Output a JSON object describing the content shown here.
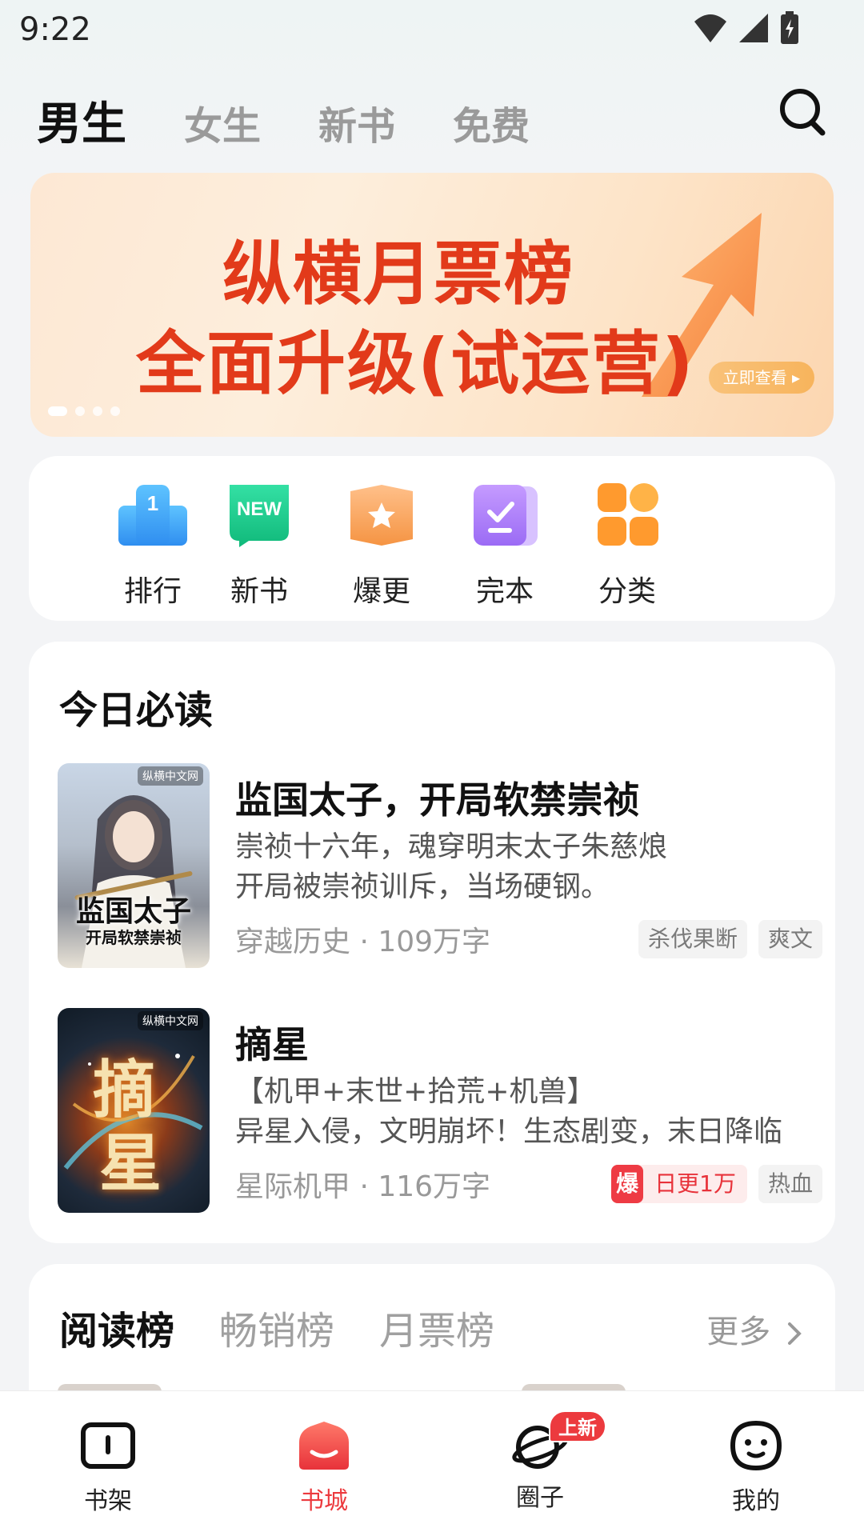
{
  "status_bar": {
    "time": "9:22"
  },
  "top_tabs": [
    "男生",
    "女生",
    "新书",
    "免费"
  ],
  "banner": {
    "line1": "纵横月票榜",
    "line2": "全面升级(试运营)",
    "cta": "立即查看 ▸",
    "slide_count": 4,
    "active_slide": 1
  },
  "quick_entries": [
    {
      "label": "排行",
      "icon": "rank-icon"
    },
    {
      "label": "新书",
      "icon": "new-book-icon"
    },
    {
      "label": "爆更",
      "icon": "burst-update-icon"
    },
    {
      "label": "完本",
      "icon": "completed-icon"
    },
    {
      "label": "分类",
      "icon": "category-icon"
    }
  ],
  "must_read": {
    "title": "今日必读",
    "books": [
      {
        "title": "监国太子，开局软禁崇祯",
        "desc_line1": "崇祯十六年，魂穿明末太子朱慈烺",
        "desc_line2": "开局被崇祯训斥，当场硬钢。",
        "meta": "穿越历史 · 109万字",
        "tags": [
          "杀伐果断",
          "爽文"
        ],
        "cover_text1": "监国太子",
        "cover_text2": "开局软禁崇祯",
        "cover_logo": "纵横中文网"
      },
      {
        "title": "摘星",
        "desc_line1": "【机甲+末世+拾荒+机兽】",
        "desc_line2": "异星入侵，文明崩坏！生态剧变，末日降临",
        "meta": "星际机甲 · 116万字",
        "hot_badge": "爆",
        "hot_tag": "日更1万",
        "tags": [
          "热血"
        ],
        "cover_text1": "摘",
        "cover_text2": "星",
        "cover_logo": "纵横中文网"
      }
    ]
  },
  "rank": {
    "tabs": [
      "阅读榜",
      "畅销榜",
      "月票榜"
    ],
    "more": "更多"
  },
  "bottom_nav": [
    {
      "label": "书架",
      "icon": "bookshelf-icon"
    },
    {
      "label": "书城",
      "icon": "bookstore-icon",
      "active": true
    },
    {
      "label": "圈子",
      "icon": "circle-icon",
      "badge": "上新"
    },
    {
      "label": "我的",
      "icon": "profile-icon"
    }
  ],
  "colors": {
    "accent": "#ec3a3e",
    "banner_text": "#e23a1a"
  }
}
